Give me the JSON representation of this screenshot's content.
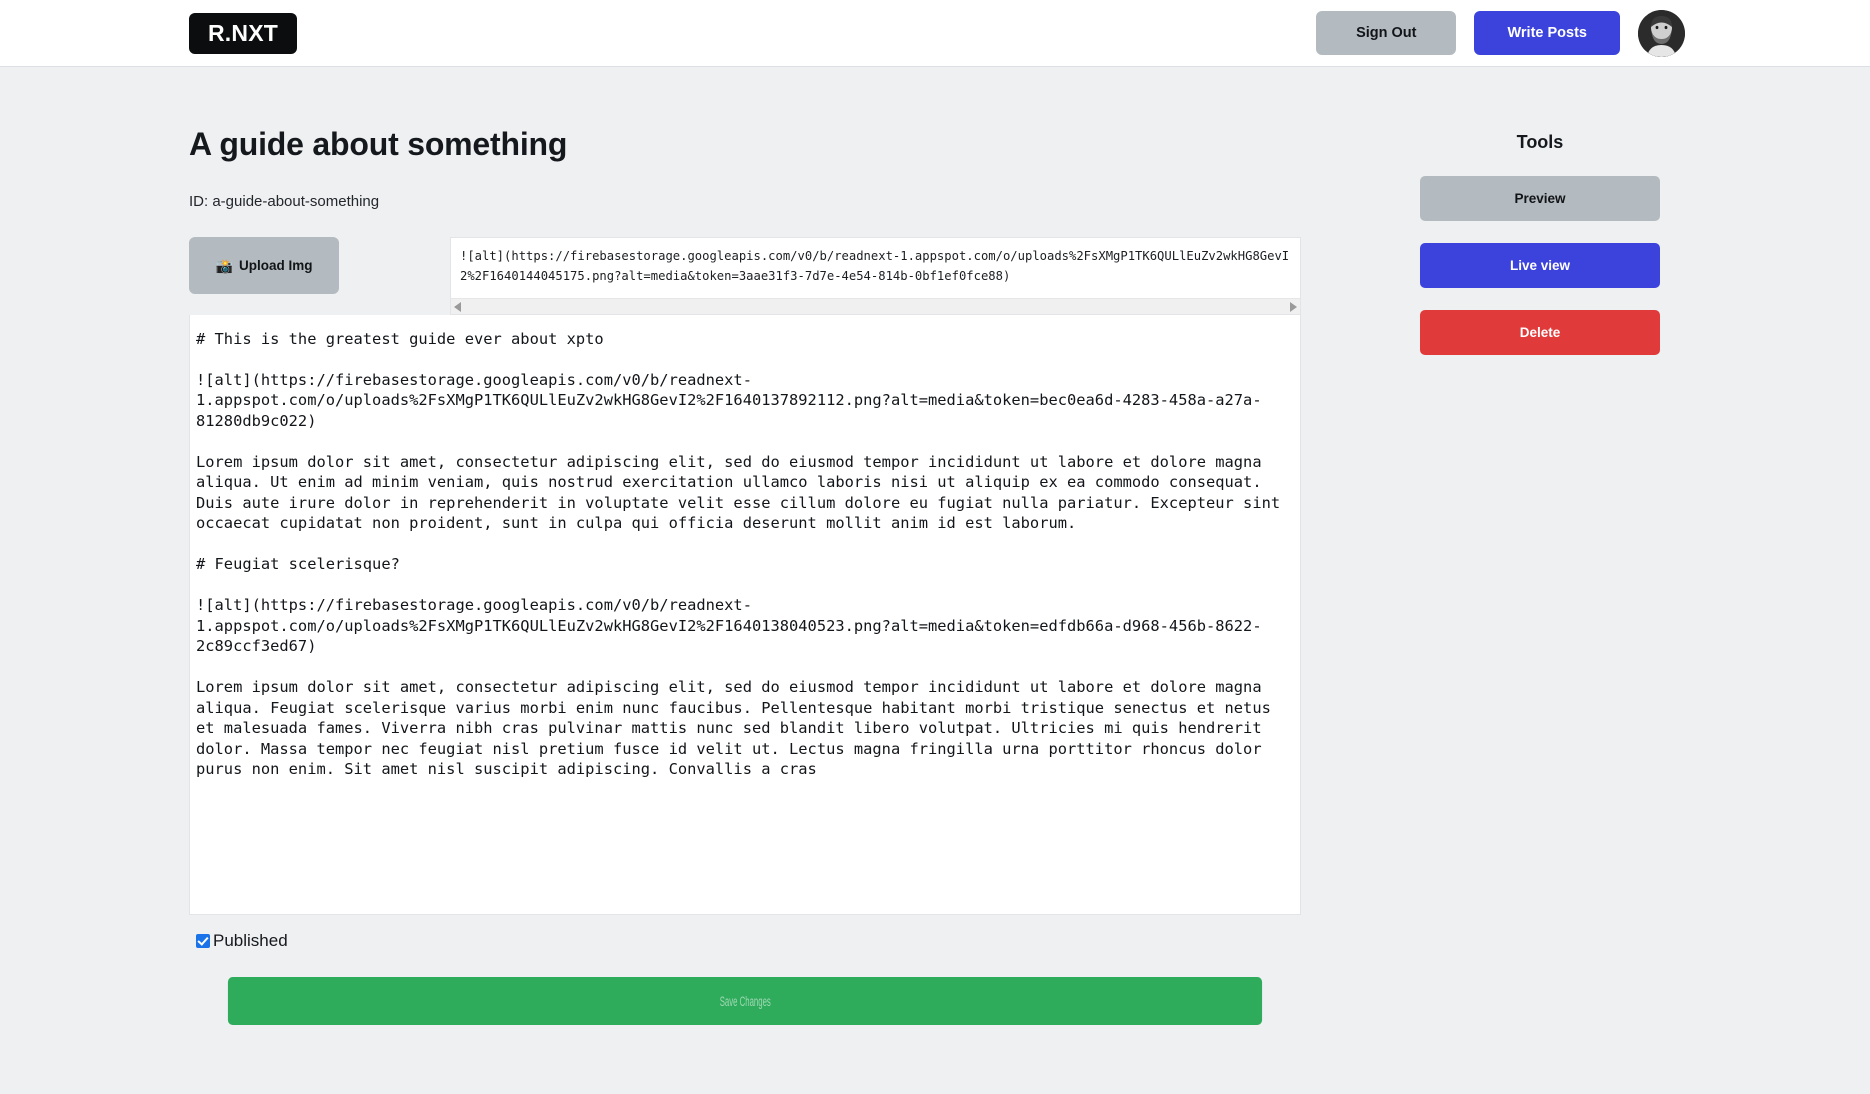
{
  "header": {
    "logo": "R.NXT",
    "sign_out_label": "Sign Out",
    "write_posts_label": "Write Posts",
    "avatar_name": "user-avatar"
  },
  "post": {
    "title": "A guide about something",
    "id_line": "ID: a-guide-about-something",
    "upload_button_label": "Upload Img",
    "upload_button_emoji": "📸",
    "uploaded_image_markdown": "![alt](https://firebasestorage.googleapis.com/v0/b/readnext-1.appspot.com/o/uploads%2FsXMgP1TK6QULlEuZv2wkHG8GevI2%2F1640144045175.png?alt=media&token=3aae31f3-7d7e-4e54-814b-0bf1ef0fce88)",
    "body_markdown": "# This is the greatest guide ever about xpto\n\n![alt](https://firebasestorage.googleapis.com/v0/b/readnext-1.appspot.com/o/uploads%2FsXMgP1TK6QULlEuZv2wkHG8GevI2%2F1640137892112.png?alt=media&token=bec0ea6d-4283-458a-a27a-81280db9c022)\n\nLorem ipsum dolor sit amet, consectetur adipiscing elit, sed do eiusmod tempor incididunt ut labore et dolore magna aliqua. Ut enim ad minim veniam, quis nostrud exercitation ullamco laboris nisi ut aliquip ex ea commodo consequat. Duis aute irure dolor in reprehenderit in voluptate velit esse cillum dolore eu fugiat nulla pariatur. Excepteur sint occaecat cupidatat non proident, sunt in culpa qui officia deserunt mollit anim id est laborum.\n\n# Feugiat scelerisque?\n\n![alt](https://firebasestorage.googleapis.com/v0/b/readnext-1.appspot.com/o/uploads%2FsXMgP1TK6QULlEuZv2wkHG8GevI2%2F1640138040523.png?alt=media&token=edfdb66a-d968-456b-8622-2c89ccf3ed67)\n\nLorem ipsum dolor sit amet, consectetur adipiscing elit, sed do eiusmod tempor incididunt ut labore et dolore magna aliqua. Feugiat scelerisque varius morbi enim nunc faucibus. Pellentesque habitant morbi tristique senectus et netus et malesuada fames. Viverra nibh cras pulvinar mattis nunc sed blandit libero volutpat. Ultricies mi quis hendrerit dolor. Massa tempor nec feugiat nisl pretium fusce id velit ut. Lectus magna fringilla urna porttitor rhoncus dolor purus non enim. Sit amet nisl suscipit adipiscing. Convallis a cras",
    "published_label": "Published",
    "published_checked": true,
    "save_label": "Save Changes"
  },
  "tools": {
    "title": "Tools",
    "buttons": [
      {
        "label": "Preview",
        "color": "#b4bbc0"
      },
      {
        "label": "Live view",
        "color": "#3b43dc"
      },
      {
        "label": "Delete",
        "color": "#e03a3a"
      }
    ]
  },
  "colors": {
    "accent_blue": "#3b43dc",
    "gray": "#b4bbc0",
    "danger_red": "#e03a3a",
    "success_green": "#2fab5c",
    "page_bg": "#eff0f2",
    "logo_bg": "#0b0d0e"
  }
}
